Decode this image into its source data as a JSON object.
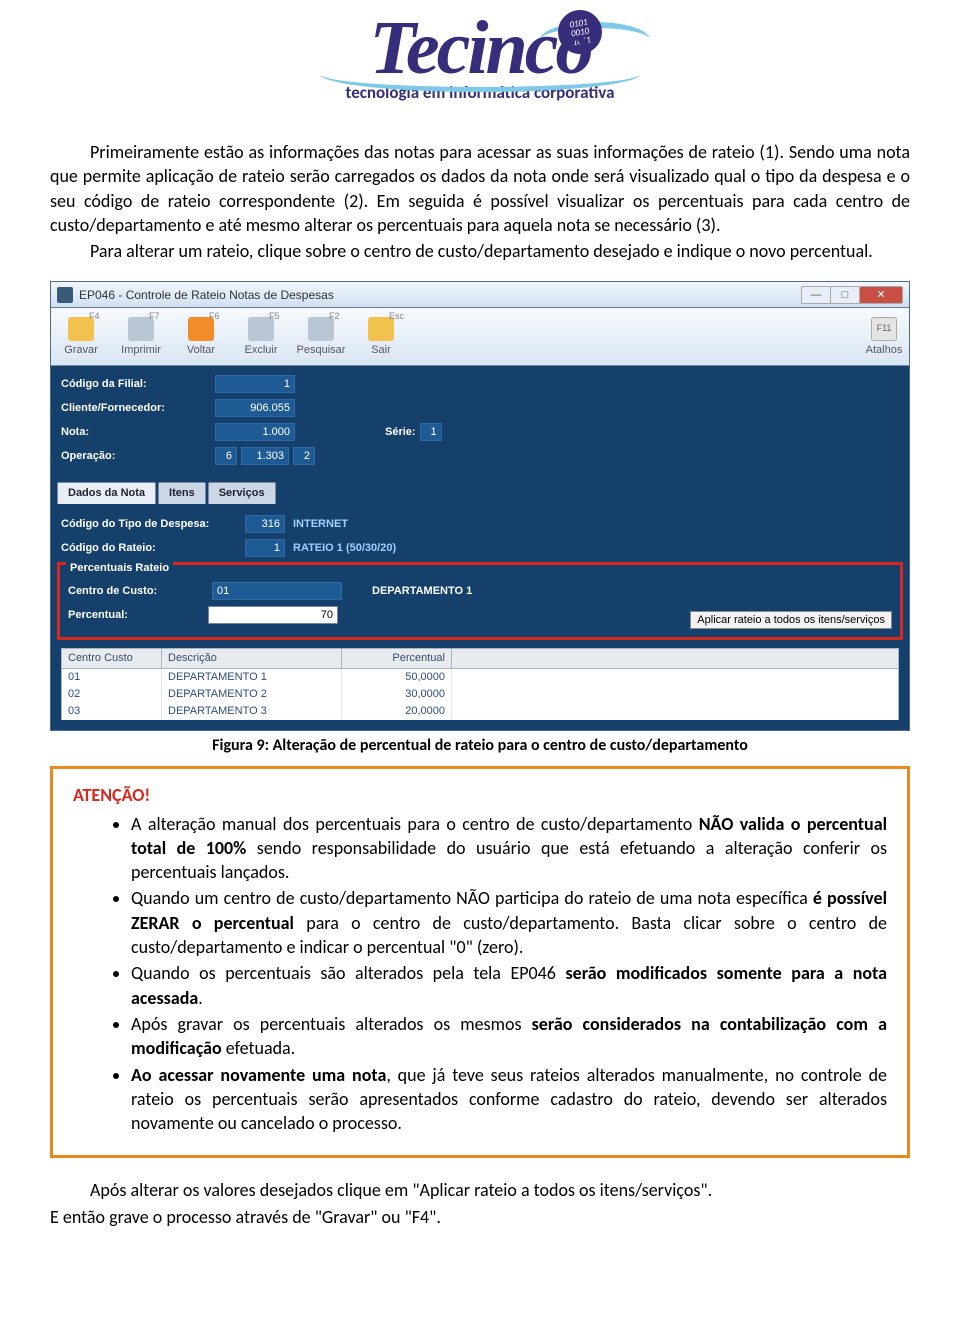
{
  "logo": {
    "word": "Tecinco",
    "globe": "01010\n00101\n10111",
    "tagline": "tecnologia em informática corporativa"
  },
  "paragraphs": {
    "p1": "Primeiramente estão as informações das notas para acessar as suas informações de rateio (1). Sendo uma nota que permite aplicação de rateio serão carregados os dados da nota onde será visualizado qual o tipo da despesa e o seu código de rateio correspondente (2). Em seguida é possível visualizar os percentuais para cada centro de custo/departamento e até mesmo alterar os percentuais para aquela nota se necessário (3).",
    "p2": "Para alterar um rateio, clique sobre o centro de custo/departamento desejado e indique o novo percentual."
  },
  "window": {
    "title": "EP046 - Controle de Rateio Notas de Despesas",
    "toolbar": [
      {
        "key": "F4",
        "label": "Gravar",
        "color": "#F2C14E"
      },
      {
        "key": "F7",
        "label": "Imprimir",
        "color": "#B9C6D4"
      },
      {
        "key": "F6",
        "label": "Voltar",
        "color": "#F28C28"
      },
      {
        "key": "F5",
        "label": "Excluir",
        "color": "#B9C6D4"
      },
      {
        "key": "F2",
        "label": "Pesquisar",
        "color": "#B9C6D4"
      },
      {
        "key": "Esc",
        "label": "Sair",
        "color": "#F2C14E"
      }
    ],
    "toolbar_right": {
      "key": "F11",
      "label": "Atalhos"
    },
    "header": {
      "filial_label": "Código da Filial:",
      "filial_value": "1",
      "cliente_label": "Cliente/Fornecedor:",
      "cliente_value": "906.055",
      "nota_label": "Nota:",
      "nota_value": "1.000",
      "serie_label": "Série:",
      "serie_value": "1",
      "oper_label": "Operação:",
      "oper_values": [
        "6",
        "1.303",
        "2"
      ]
    },
    "tabs": [
      "Dados da Nota",
      "Itens",
      "Serviços"
    ],
    "pane": {
      "tipo_label": "Código do Tipo de Despesa:",
      "tipo_value": "316",
      "tipo_desc": "INTERNET",
      "rateio_label": "Código do Rateio:",
      "rateio_value": "1",
      "rateio_desc": "RATEIO 1 (50/30/20)"
    },
    "percentuais": {
      "legend": "Percentuais Rateio",
      "cc_label": "Centro de Custo:",
      "cc_value": "01",
      "cc_desc": "DEPARTAMENTO 1",
      "perc_label": "Percentual:",
      "perc_value": "70",
      "apply_btn": "Aplicar rateio a todos os itens/serviços"
    },
    "grid": {
      "headers": [
        "Centro Custo",
        "Descrição",
        "Percentual"
      ],
      "rows": [
        {
          "c": "01",
          "d": "DEPARTAMENTO 1",
          "p": "50,0000"
        },
        {
          "c": "02",
          "d": "DEPARTAMENTO 2",
          "p": "30,0000"
        },
        {
          "c": "03",
          "d": "DEPARTAMENTO 3",
          "p": "20,0000"
        }
      ]
    }
  },
  "figure_caption": "Figura 9: Alteração de percentual de rateio para o centro de custo/departamento",
  "attention": {
    "title": "ATENÇÃO!",
    "items": [
      {
        "pre": "A alteração manual dos percentuais para o centro de custo/departamento ",
        "b1": "NÃO valida o percentual total de 100%",
        "post": " sendo responsabilidade do usuário que está efetuando a alteração conferir os percentuais lançados."
      },
      {
        "pre": "Quando um centro de custo/departamento NÃO participa do rateio de uma nota específica ",
        "b1": "é possível ZERAR o percentual",
        "post": " para o centro de custo/departamento. Basta clicar sobre o centro de custo/departamento e indicar o percentual \"0\" (zero)."
      },
      {
        "pre": "Quando os percentuais são alterados pela tela EP046 ",
        "b1": "serão modificados somente para a nota acessada",
        "post": "."
      },
      {
        "pre": "Após gravar os percentuais alterados os mesmos ",
        "b1": "serão considerados na contabilização com a modificação",
        "post": " efetuada."
      },
      {
        "pre": "",
        "b1": "Ao acessar novamente uma nota",
        "post": ", que já teve seus rateios alterados manualmente, no controle de rateio os percentuais serão apresentados conforme cadastro do rateio, devendo ser alterados novamente ou cancelado o processo."
      }
    ]
  },
  "footer": {
    "p1": "Após alterar os valores desejados clique em \"Aplicar rateio a todos os itens/serviços\".",
    "p2": "E então grave o processo através de \"Gravar\" ou \"F4\"."
  }
}
